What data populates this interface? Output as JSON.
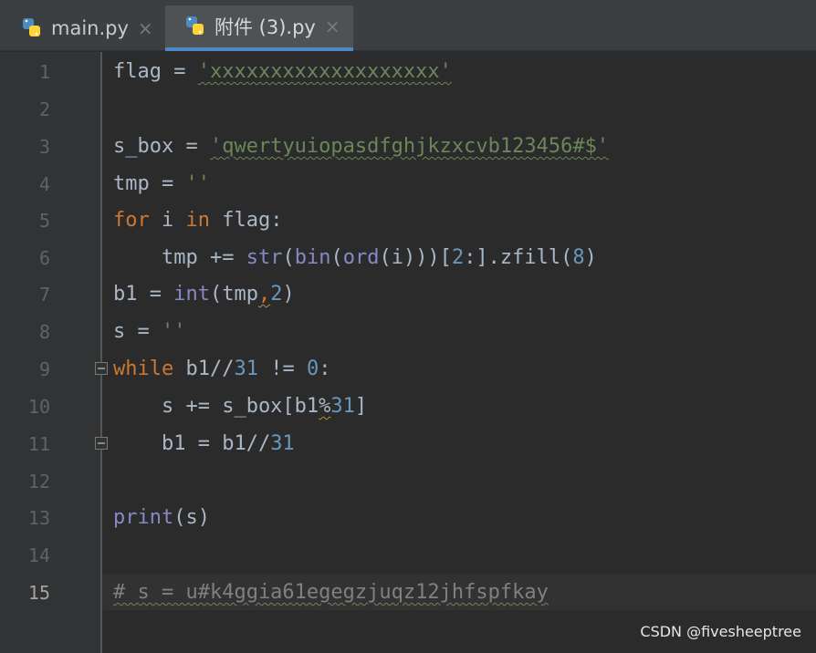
{
  "tabs": [
    {
      "label": "main.py",
      "close": "×",
      "active": false
    },
    {
      "label": "附件 (3).py",
      "close": "×",
      "active": true
    }
  ],
  "lines": [
    {
      "n": "1"
    },
    {
      "n": "2"
    },
    {
      "n": "3"
    },
    {
      "n": "4"
    },
    {
      "n": "5"
    },
    {
      "n": "6"
    },
    {
      "n": "7"
    },
    {
      "n": "8"
    },
    {
      "n": "9"
    },
    {
      "n": "10"
    },
    {
      "n": "11"
    },
    {
      "n": "12"
    },
    {
      "n": "13"
    },
    {
      "n": "14"
    },
    {
      "n": "15"
    }
  ],
  "code": {
    "l1": {
      "a": "flag = ",
      "b": "'xxxxxxxxxxxxxxxxxxx'"
    },
    "l3": {
      "a": "s_box = ",
      "b": "'qwertyuiopasdfghjkzxcvb123456#$'"
    },
    "l4": {
      "a": "tmp = ",
      "b": "''"
    },
    "l5": {
      "k1": "for",
      "m": " i ",
      "k2": "in",
      "e": " flag:"
    },
    "l6": {
      "a": "    tmp += ",
      "f1": "str",
      "p1": "(",
      "f2": "bin",
      "p2": "(",
      "f3": "ord",
      "p3": "(i)))[",
      "n1": "2",
      "p4": ":].zfill(",
      "n2": "8",
      "p5": ")"
    },
    "l7": {
      "a": "b1 = ",
      "f": "int",
      "p": "(tmp",
      "c": ",",
      "n": "2",
      "e": ")"
    },
    "l8": {
      "a": "s = ",
      "b": "''"
    },
    "l9": {
      "k": "while",
      "a": " b1//",
      "n1": "31",
      "m": " != ",
      "n2": "0",
      "e": ":"
    },
    "l10": {
      "a": "    s += s_box[b1",
      "op": "%",
      "n": "31",
      "e": "]"
    },
    "l11": {
      "a": "    b1 = b1//",
      "n": "31"
    },
    "l13": {
      "f": "print",
      "e": "(s)"
    },
    "l15": {
      "c": "# s = u#k4ggia61egegzjuqz12jhfspfkay"
    }
  },
  "watermark": "CSDN @fivesheeptree",
  "colors": {
    "keyword": "#cc7832",
    "string": "#6a8759",
    "number": "#6897bb",
    "builtin": "#8888c6",
    "text": "#a9b7c6",
    "comment": "#808080"
  }
}
